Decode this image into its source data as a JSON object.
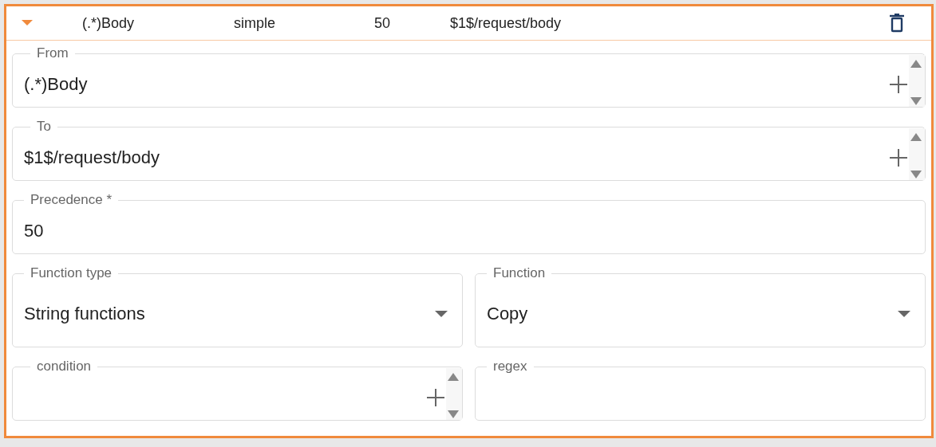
{
  "header": {
    "expanded": true,
    "cells": [
      "(.*)Body",
      "simple",
      "50",
      "$1$/request/body"
    ]
  },
  "rows": [
    [
      {
        "kind": "expandable",
        "label": "From",
        "value": "(.*)Body"
      }
    ],
    [
      {
        "kind": "expandable",
        "label": "To",
        "value": "$1$/request/body"
      }
    ],
    [
      {
        "kind": "text",
        "label": "Precedence *",
        "value": "50"
      }
    ],
    [
      {
        "kind": "select",
        "label": "Function type",
        "value": "String functions"
      },
      {
        "kind": "select",
        "label": "Function",
        "value": "Copy"
      }
    ],
    [
      {
        "kind": "expandable",
        "label": "condition"
      },
      {
        "kind": "text",
        "label": "regex"
      }
    ]
  ]
}
